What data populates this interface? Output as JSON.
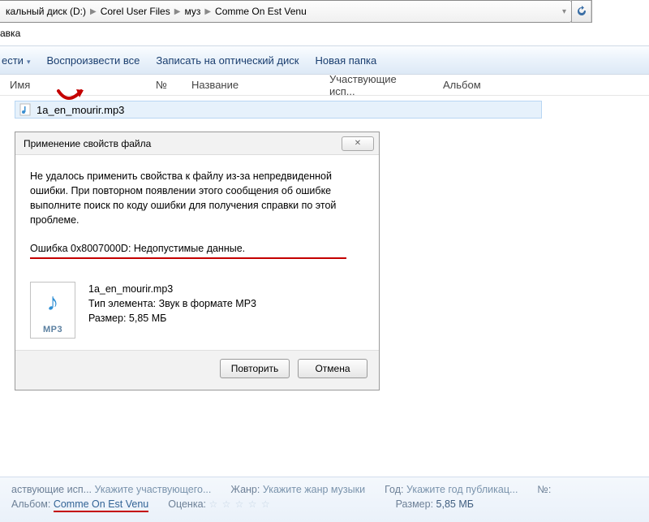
{
  "breadcrumb": {
    "p0": "кальный диск (D:)",
    "p1": "Corel User Files",
    "p2": "муз",
    "p3": "Comme On Est Venu"
  },
  "menubar": {
    "help": "авка"
  },
  "commandbar": {
    "play": "ести",
    "play_all": "Воспроизвести все",
    "burn": "Записать на оптический диск",
    "newfolder": "Новая папка"
  },
  "columns": {
    "name": "Имя",
    "num": "№",
    "title": "Название",
    "artists": "Участвующие исп...",
    "album": "Альбом"
  },
  "file": {
    "name": "1a_en_mourir.mp3"
  },
  "dialog": {
    "title": "Применение свойств файла",
    "msg": "Не удалось применить свойства к файлу из-за непредвиденной ошибки. При повторном появлении этого сообщения об ошибке выполните поиск по коду ошибки для получения справки по этой проблеме.",
    "error": "Ошибка 0x8007000D: Недопустимые данные.",
    "filename": "1a_en_mourir.mp3",
    "type_lbl": "Тип элемента: Звук в формате MP3",
    "size_lbl": "Размер: 5,85 МБ",
    "retry": "Повторить",
    "cancel": "Отмена"
  },
  "details": {
    "artists_lbl": "аствующие исп...",
    "artists_hint": "Укажите участвующего...",
    "genre_lbl": "Жанр:",
    "genre_hint": "Укажите жанр музыки",
    "year_lbl": "Год:",
    "year_hint": "Укажите год публикац...",
    "no_lbl": "№:",
    "album_lbl": "Альбом:",
    "album_val": "Comme On Est Venu",
    "rating_lbl": "Оценка:",
    "size_lbl": "Размер:",
    "size_val": "5,85 МБ"
  }
}
